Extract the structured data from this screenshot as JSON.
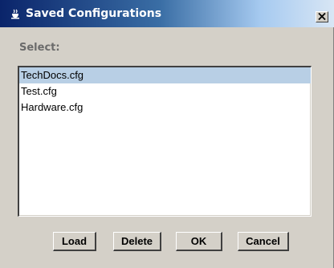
{
  "window": {
    "title": "Saved Configurations",
    "title_icon": "java-cup-icon",
    "close_label": "×"
  },
  "content": {
    "select_label": "Select:",
    "items": [
      {
        "label": "TechDocs.cfg",
        "selected": true
      },
      {
        "label": "Test.cfg",
        "selected": false
      },
      {
        "label": "Hardware.cfg",
        "selected": false
      }
    ]
  },
  "buttons": {
    "load": "Load",
    "delete": "Delete",
    "ok": "OK",
    "cancel": "Cancel"
  },
  "colors": {
    "title_start": "#0a246a",
    "title_end": "#d8e6f5",
    "selection": "#b8cfe5",
    "dialog_bg": "#d4d0c8"
  }
}
